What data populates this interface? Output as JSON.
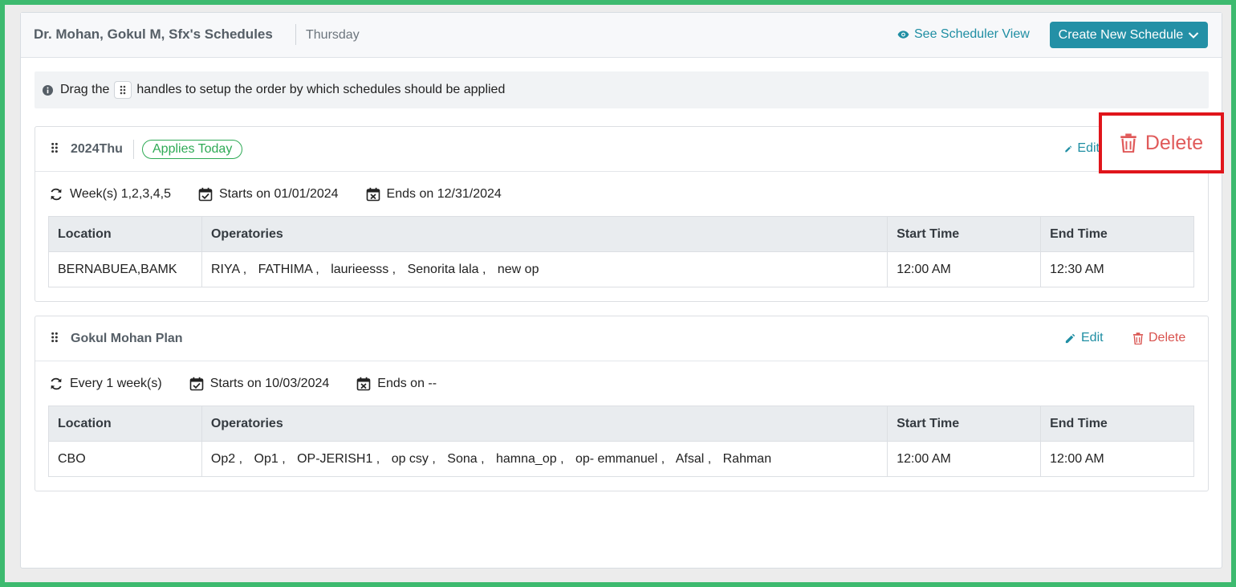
{
  "header": {
    "title": "Dr. Mohan, Gokul M, Sfx's Schedules",
    "day": "Thursday",
    "scheduler_link": "See Scheduler View",
    "create_button": "Create New Schedule"
  },
  "info": {
    "prefix": "Drag the",
    "suffix": "handles to setup the order by which schedules should be applied"
  },
  "table_headers": {
    "location": "Location",
    "operatories": "Operatories",
    "start_time": "Start Time",
    "end_time": "End Time"
  },
  "schedules": [
    {
      "name": "2024Thu",
      "badge": "Applies Today",
      "edit_label": "Edit",
      "delete_label": "Delete",
      "recurrence": "Week(s) 1,2,3,4,5",
      "starts": "Starts on 01/01/2024",
      "ends": "Ends on 12/31/2024",
      "row": {
        "location": "BERNABUEA,BAMK",
        "operatories": [
          "RIYA",
          "FATHIMA",
          "laurieesss",
          "Senorita lala",
          "new op"
        ],
        "start_time": "12:00 AM",
        "end_time": "12:30 AM"
      }
    },
    {
      "name": "Gokul Mohan Plan",
      "edit_label": "Edit",
      "delete_label": "Delete",
      "recurrence": "Every 1 week(s)",
      "starts": "Starts on 10/03/2024",
      "ends": "Ends on --",
      "row": {
        "location": "CBO",
        "operatories": [
          "Op2",
          "Op1",
          "OP-JERISH1",
          "op csy",
          "Sona",
          "hamna_op",
          "op- emmanuel",
          "Afsal",
          "Rahman"
        ],
        "start_time": "12:00 AM",
        "end_time": "12:00 AM"
      }
    }
  ],
  "highlight": {
    "label": "Delete"
  },
  "colors": {
    "accent": "#2490a6",
    "link": "#1f8ea3",
    "danger": "#d9534f",
    "success": "#2eaa55",
    "highlight_border": "#e0151b"
  }
}
